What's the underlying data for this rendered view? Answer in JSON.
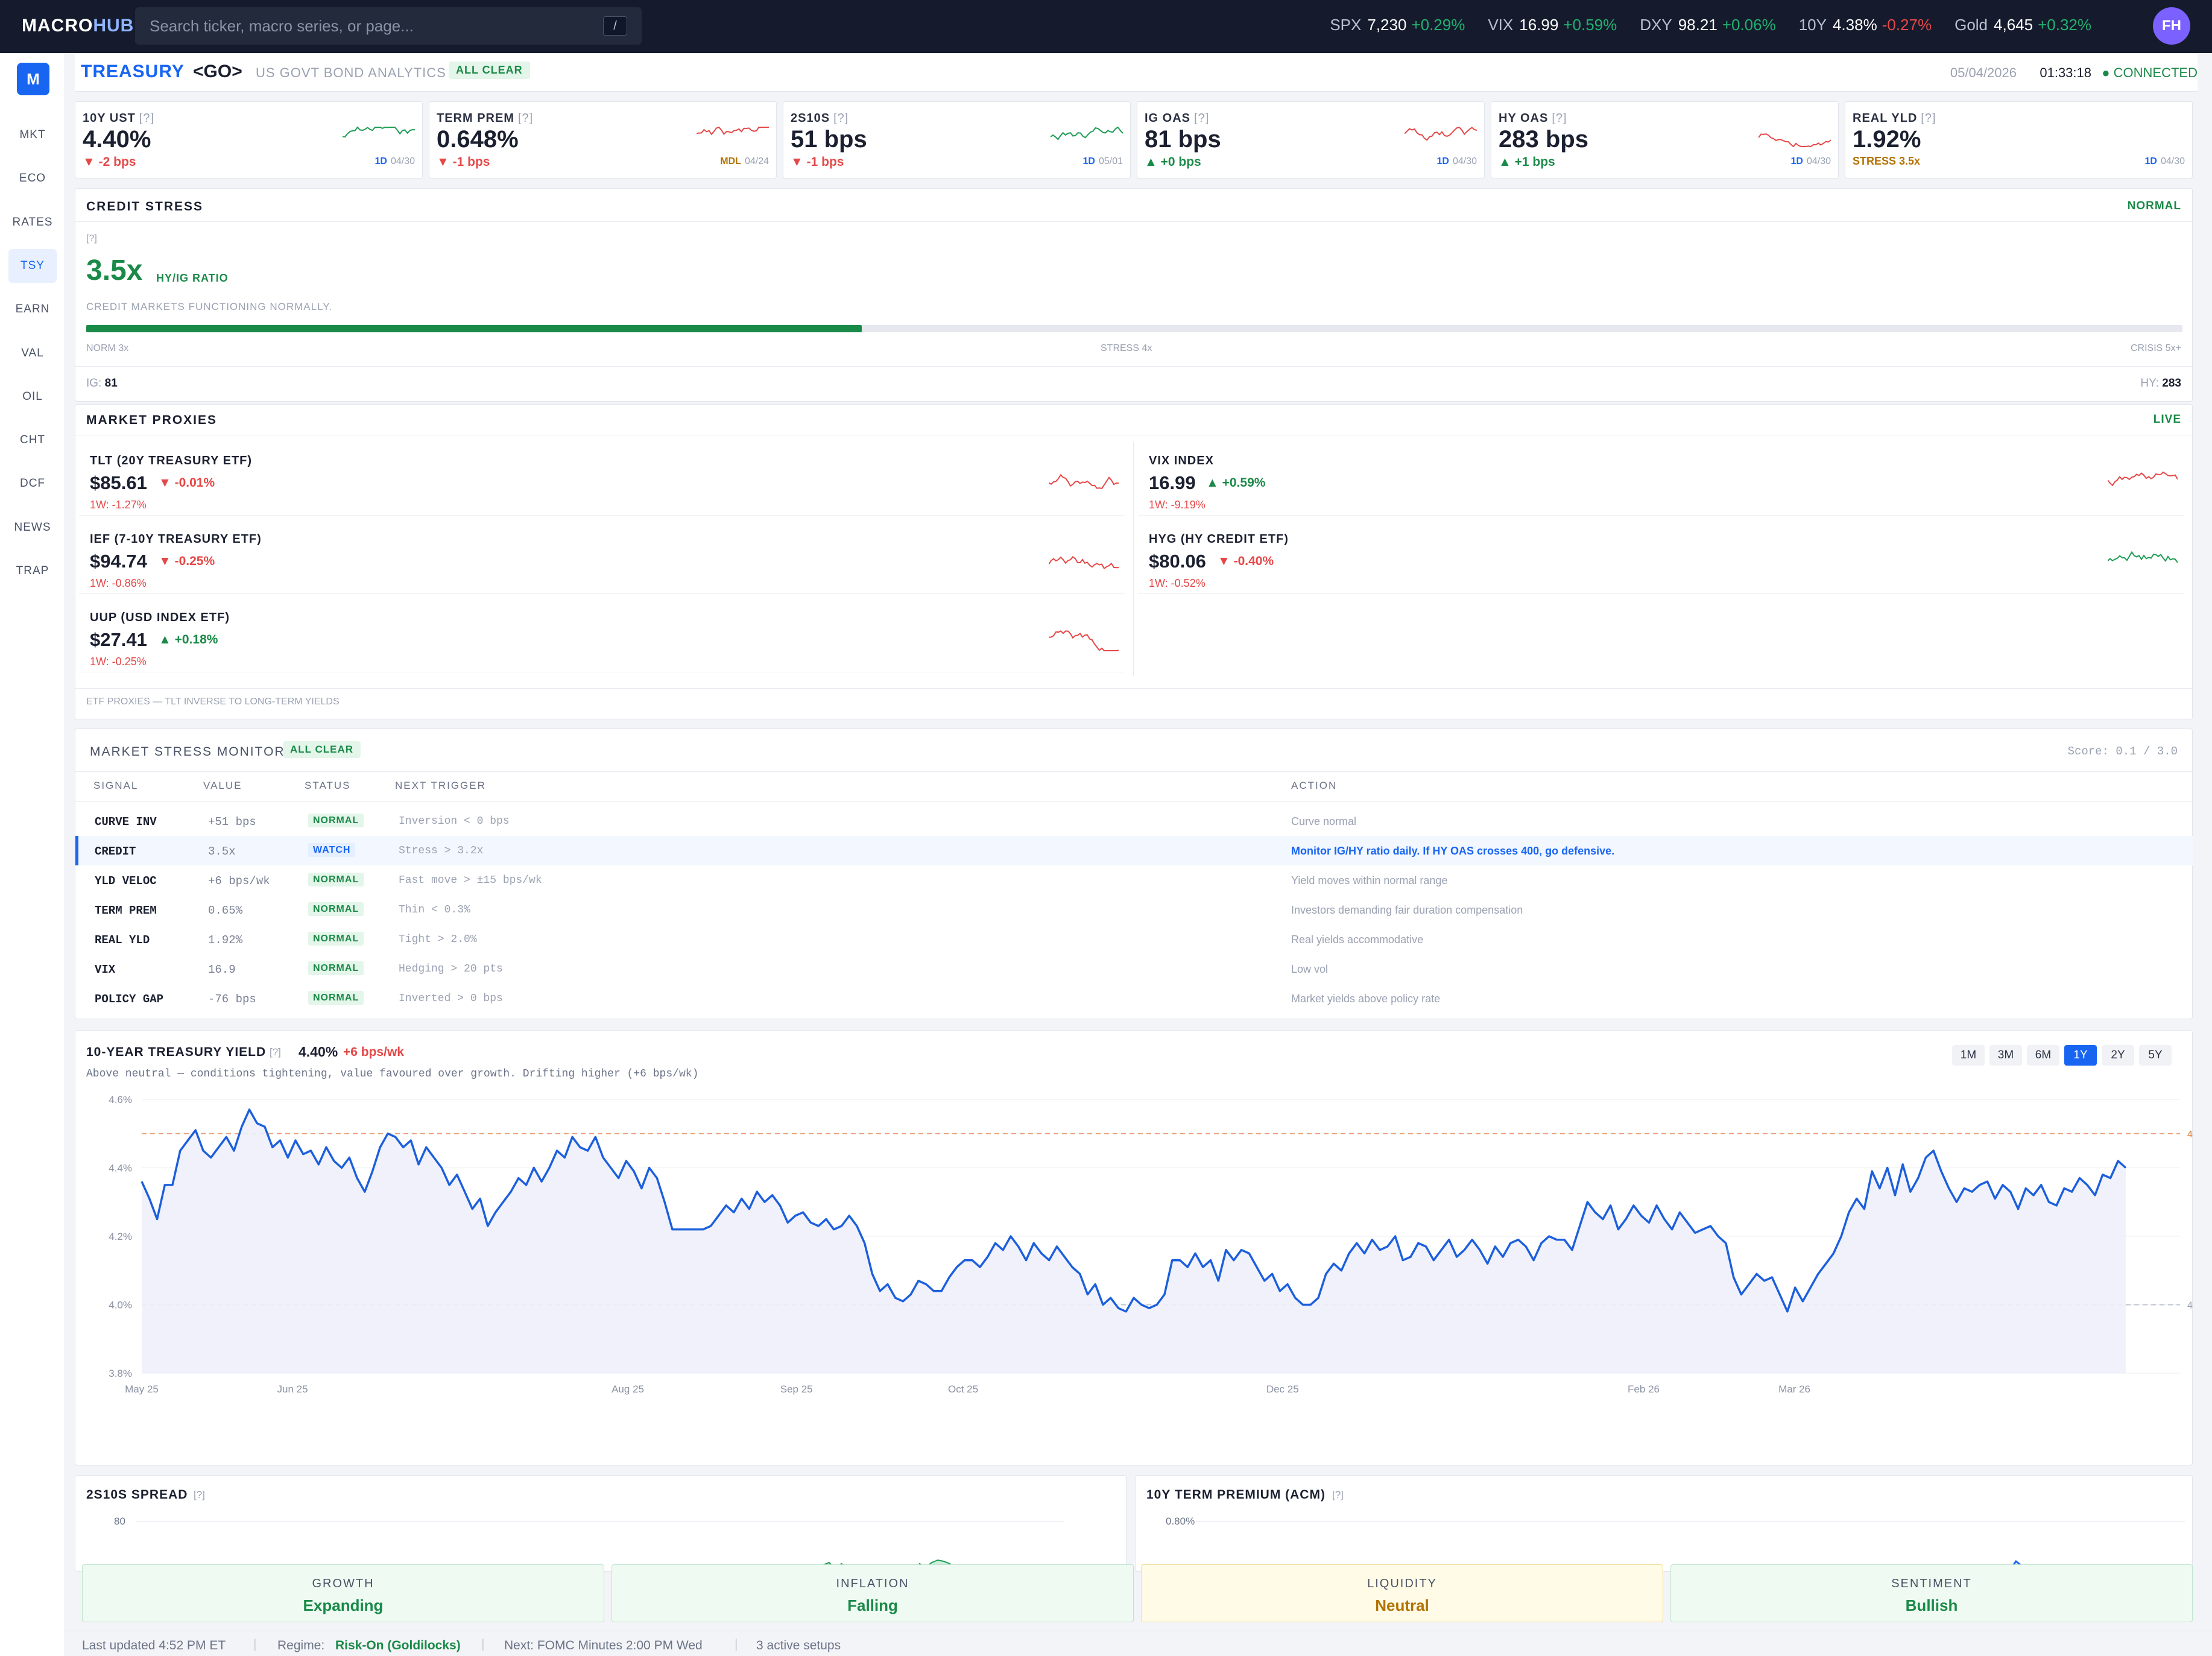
{
  "topbar": {
    "logo_a": "MACRO",
    "logo_b": "HUB",
    "search_placeholder": "Search ticker, macro series, or page...",
    "search_key": "/",
    "avatar": "FH",
    "tickers": [
      {
        "name": "SPX",
        "value": "7,230",
        "change": "+0.29%",
        "dir": "up"
      },
      {
        "name": "VIX",
        "value": "16.99",
        "change": "+0.59%",
        "dir": "up"
      },
      {
        "name": "DXY",
        "value": "98.21",
        "change": "+0.06%",
        "dir": "up"
      },
      {
        "name": "10Y",
        "value": "4.38%",
        "change": "-0.27%",
        "dir": "dn"
      },
      {
        "name": "Gold",
        "value": "4,645",
        "change": "+0.32%",
        "dir": "up"
      }
    ]
  },
  "sidebar": {
    "logo": "M",
    "items": [
      "MKT",
      "ECO",
      "RATES",
      "TSY",
      "EARN",
      "VAL",
      "OIL",
      "CHT",
      "DCF",
      "NEWS",
      "TRAP"
    ],
    "active": "TSY"
  },
  "header": {
    "title": "TREASURY",
    "go": "<GO>",
    "subtitle": "US GOVT BOND ANALYTICS",
    "badge": "ALL CLEAR",
    "date": "05/04/2026",
    "time": "01:33:18",
    "status": "● CONNECTED"
  },
  "cards": [
    {
      "label": "10Y UST",
      "q": "[?]",
      "value": "4.40%",
      "change": "▼ -2 bps",
      "dir": "dn",
      "period": "1D",
      "date": "04/30",
      "spark_color": "#1f9d55"
    },
    {
      "label": "TERM PREM",
      "q": "[?]",
      "value": "0.648%",
      "change": "▼ -1 bps",
      "dir": "dn",
      "period": "MDL",
      "date": "04/24",
      "spark_color": "#e54848"
    },
    {
      "label": "2S10S",
      "q": "[?]",
      "value": "51 bps",
      "change": "▼ -1 bps",
      "dir": "dn",
      "period": "1D",
      "date": "05/01",
      "spark_color": "#1f9d55"
    },
    {
      "label": "IG OAS",
      "q": "[?]",
      "value": "81 bps",
      "change": "▲ +0 bps",
      "dir": "up",
      "period": "1D",
      "date": "04/30",
      "spark_color": "#e54848"
    },
    {
      "label": "HY OAS",
      "q": "[?]",
      "value": "283 bps",
      "change": "▲ +1 bps",
      "dir": "up",
      "period": "1D",
      "date": "04/30",
      "spark_color": "#e54848"
    },
    {
      "label": "REAL YLD",
      "q": "[?]",
      "value": "1.92%",
      "change": "STRESS 3.5x",
      "dir": "amber",
      "period": "1D",
      "date": "04/30",
      "spark_color": ""
    }
  ],
  "credit": {
    "title": "CREDIT STRESS",
    "status": "NORMAL",
    "q": "[?]",
    "ratio": "3.5x",
    "ratio_label": "HY/IG RATIO",
    "desc": "CREDIT MARKETS FUNCTIONING NORMALLY.",
    "progress": 0.37,
    "scale_left": "NORM 3x",
    "scale_mid": "STRESS 4x",
    "scale_right": "CRISIS 5x+",
    "ig_label": "IG:",
    "ig_value": "81",
    "hy_label": "HY:",
    "hy_value": "283"
  },
  "proxies": {
    "title": "MARKET PROXIES",
    "status": "LIVE",
    "note": "ETF PROXIES — TLT INVERSE TO LONG-TERM YIELDS",
    "items": [
      {
        "name": "TLT (20Y TREASURY ETF)",
        "price": "$85.61",
        "change": "▼ -0.01%",
        "dir": "dn",
        "week": "1W: -1.27%"
      },
      {
        "name": "VIX INDEX",
        "price": "16.99",
        "change": "▲ +0.59%",
        "dir": "up",
        "week": "1W: -9.19%"
      },
      {
        "name": "IEF (7-10Y TREASURY ETF)",
        "price": "$94.74",
        "change": "▼ -0.25%",
        "dir": "dn",
        "week": "1W: -0.86%"
      },
      {
        "name": "HYG (HY CREDIT ETF)",
        "price": "$80.06",
        "change": "▼ -0.40%",
        "dir": "dn",
        "week": "1W: -0.52%"
      },
      {
        "name": "UUP (USD INDEX ETF)",
        "price": "$27.41",
        "change": "▲ +0.18%",
        "dir": "up",
        "week": "1W: -0.25%"
      }
    ]
  },
  "stress": {
    "title": "MARKET STRESS MONITOR",
    "badge": "ALL CLEAR",
    "score": "Score: 0.1 / 3.0",
    "headers": [
      "SIGNAL",
      "VALUE",
      "STATUS",
      "NEXT TRIGGER",
      "ACTION"
    ],
    "rows": [
      {
        "signal": "CURVE INV",
        "value": "+51 bps",
        "status": "NORMAL",
        "trigger": "Inversion < 0 bps",
        "action": "Curve normal"
      },
      {
        "signal": "CREDIT",
        "value": "3.5x",
        "status": "WATCH",
        "trigger": "Stress > 3.2x",
        "action": "Monitor IG/HY ratio daily. If HY OAS crosses 400, go defensive."
      },
      {
        "signal": "YLD VELOC",
        "value": "+6 bps/wk",
        "status": "NORMAL",
        "trigger": "Fast move > ±15 bps/wk",
        "action": "Yield moves within normal range"
      },
      {
        "signal": "TERM PREM",
        "value": "0.65%",
        "status": "NORMAL",
        "trigger": "Thin < 0.3%",
        "action": "Investors demanding fair duration compensation"
      },
      {
        "signal": "REAL YLD",
        "value": "1.92%",
        "status": "NORMAL",
        "trigger": "Tight > 2.0%",
        "action": "Real yields accommodative"
      },
      {
        "signal": "VIX",
        "value": "16.9",
        "status": "NORMAL",
        "trigger": "Hedging > 20 pts",
        "action": "Low vol"
      },
      {
        "signal": "POLICY GAP",
        "value": "-76 bps",
        "status": "NORMAL",
        "trigger": "Inverted > 0 bps",
        "action": "Market yields above policy rate"
      }
    ]
  },
  "yield": {
    "title": "10-YEAR TREASURY YIELD",
    "q": "[?]",
    "value": "4.40%",
    "change": "+6 bps/wk",
    "desc": "Above neutral — conditions tightening, value favoured over growth. Drifting higher (+6 bps/wk)",
    "ranges": [
      "1M",
      "3M",
      "6M",
      "1Y",
      "2Y",
      "5Y"
    ],
    "active_range": "1Y",
    "ref_high_label": "4",
    "ref_low_label": "4"
  },
  "chart_data": {
    "type": "line",
    "title": "10-YEAR TREASURY YIELD",
    "ylim": [
      3.8,
      4.6
    ],
    "yticks": [
      "4.6%",
      "4.4%",
      "4.2%",
      "4.0%",
      "3.8%"
    ],
    "xticks": [
      "May 25",
      "Jun 25",
      "Aug 25",
      "Sep 25",
      "Oct 25",
      "Dec 25",
      "Feb 26",
      "Mar 26"
    ],
    "reference_lines": [
      4.5,
      4.0
    ],
    "series": [
      {
        "values": [
          4.36,
          4.31,
          4.25,
          4.35,
          4.35,
          4.45,
          4.48,
          4.51,
          4.45,
          4.43,
          4.46,
          4.49,
          4.45,
          4.52,
          4.57,
          4.53,
          4.52,
          4.46,
          4.48,
          4.43,
          4.48,
          4.44,
          4.45,
          4.41,
          4.46,
          4.42,
          4.4,
          4.43,
          4.37,
          4.33,
          4.39,
          4.46,
          4.5,
          4.49,
          4.46,
          4.48,
          4.41,
          4.46,
          4.43,
          4.4,
          4.35,
          4.38,
          4.33,
          4.28,
          4.31,
          4.23,
          4.27,
          4.3,
          4.33,
          4.37,
          4.35,
          4.4,
          4.36,
          4.4,
          4.45,
          4.43,
          4.49,
          4.46,
          4.45,
          4.49,
          4.43,
          4.4,
          4.37,
          4.42,
          4.39,
          4.34,
          4.4,
          4.37,
          4.3,
          4.22,
          4.22,
          4.22,
          4.22,
          4.22,
          4.23,
          4.26,
          4.29,
          4.27,
          4.31,
          4.28,
          4.33,
          4.3,
          4.32,
          4.29,
          4.24,
          4.26,
          4.27,
          4.24,
          4.23,
          4.25,
          4.22,
          4.23,
          4.26,
          4.23,
          4.18,
          4.09,
          4.04,
          4.06,
          4.02,
          4.01,
          4.03,
          4.07,
          4.06,
          4.04,
          4.04,
          4.08,
          4.11,
          4.13,
          4.13,
          4.11,
          4.14,
          4.18,
          4.16,
          4.2,
          4.17,
          4.13,
          4.18,
          4.15,
          4.13,
          4.17,
          4.14,
          4.11,
          4.09,
          4.03,
          4.06,
          4.0,
          4.02,
          3.99,
          3.98,
          4.02,
          4.0,
          3.99,
          4.0,
          4.03,
          4.13,
          4.13,
          4.11,
          4.15,
          4.11,
          4.13,
          4.07,
          4.16,
          4.13,
          4.16,
          4.15,
          4.11,
          4.07,
          4.09,
          4.04,
          4.06,
          4.02,
          4.0,
          4.0,
          4.02,
          4.09,
          4.12,
          4.1,
          4.15,
          4.18,
          4.15,
          4.19,
          4.16,
          4.17,
          4.2,
          4.13,
          4.14,
          4.18,
          4.17,
          4.13,
          4.16,
          4.19,
          4.14,
          4.16,
          4.19,
          4.16,
          4.12,
          4.17,
          4.14,
          4.18,
          4.19,
          4.17,
          4.13,
          4.18,
          4.2,
          4.19,
          4.19,
          4.16,
          4.23,
          4.3,
          4.27,
          4.25,
          4.29,
          4.22,
          4.25,
          4.29,
          4.26,
          4.24,
          4.29,
          4.25,
          4.22,
          4.27,
          4.24,
          4.21,
          4.22,
          4.23,
          4.2,
          4.18,
          4.08,
          4.03,
          4.06,
          4.09,
          4.07,
          4.08,
          4.03,
          3.98,
          4.05,
          4.01,
          4.05,
          4.09,
          4.12,
          4.15,
          4.2,
          4.27,
          4.31,
          4.28,
          4.39,
          4.34,
          4.4,
          4.32,
          4.41,
          4.33,
          4.37,
          4.43,
          4.45,
          4.39,
          4.34,
          4.3,
          4.34,
          4.33,
          4.35,
          4.36,
          4.31,
          4.35,
          4.33,
          4.28,
          4.34,
          4.32,
          4.35,
          4.3,
          4.29,
          4.34,
          4.33,
          4.37,
          4.35,
          4.32,
          4.38,
          4.37,
          4.42,
          4.4
        ]
      }
    ]
  },
  "spread": {
    "title": "2S10S SPREAD",
    "q": "[?]",
    "ytick": "80"
  },
  "termprem": {
    "title": "10Y TERM PREMIUM (ACM)",
    "q": "[?]",
    "ytick": "0.80%"
  },
  "regime": [
    {
      "label": "GROWTH",
      "value": "Expanding",
      "tone": "green"
    },
    {
      "label": "INFLATION",
      "value": "Falling",
      "tone": "green"
    },
    {
      "label": "LIQUIDITY",
      "value": "Neutral",
      "tone": "amber"
    },
    {
      "label": "SENTIMENT",
      "value": "Bullish",
      "tone": "green"
    }
  ],
  "footer": {
    "updated": "Last updated 4:52 PM ET",
    "regime_label": "Regime:",
    "regime_value": "Risk-On (Goldilocks)",
    "next": "Next: FOMC Minutes 2:00 PM Wed",
    "setups": "3 active setups"
  }
}
